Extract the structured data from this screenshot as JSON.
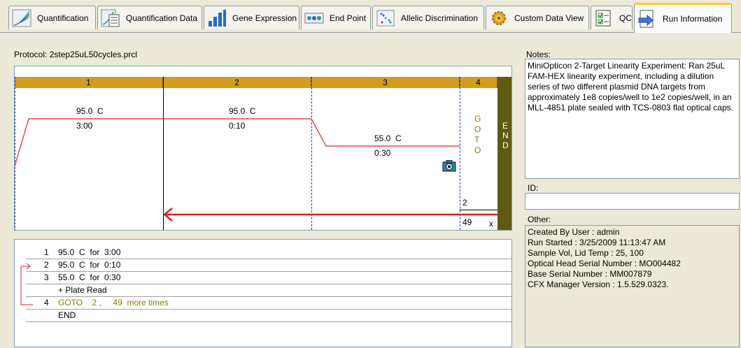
{
  "tabs": [
    {
      "label": "Quantification",
      "icon": "quantification-chart-icon",
      "active": false
    },
    {
      "label": "Quantification Data",
      "icon": "quantification-data-icon",
      "active": false
    },
    {
      "label": "Gene Expression",
      "icon": "gene-expression-bars-icon",
      "active": false
    },
    {
      "label": "End Point",
      "icon": "end-point-icon",
      "active": false
    },
    {
      "label": "Allelic Discrimination",
      "icon": "allelic-discrimination-icon",
      "active": false
    },
    {
      "label": "Custom Data View",
      "icon": "custom-data-view-gear-icon",
      "active": false
    },
    {
      "label": "QC",
      "icon": "qc-checklist-icon",
      "active": false
    },
    {
      "label": "Run Information",
      "icon": "run-information-icon",
      "active": true
    }
  ],
  "protocol": {
    "label": "Protocol: 2step25uL50cycles.prcl",
    "steps": [
      {
        "number": "1",
        "temp": "95.0",
        "unit": "C",
        "time": "3:00"
      },
      {
        "number": "2",
        "temp": "95.0",
        "unit": "C",
        "time": "0:10"
      },
      {
        "number": "3",
        "temp": "55.0",
        "unit": "C",
        "time": "0:30"
      },
      {
        "number": "4"
      }
    ],
    "goto_letters": [
      "G",
      "O",
      "T",
      "O"
    ],
    "end_letters": [
      "E",
      "N",
      "D"
    ],
    "goto_step": "2",
    "goto_repeats": "49",
    "goto_repeat_suffix": "x"
  },
  "step_list": [
    {
      "num": "1",
      "text": "95.0  C  for  3:00"
    },
    {
      "num": "2",
      "text": "95.0  C  for  0:10"
    },
    {
      "num": "3",
      "text": "55.0  C  for  0:30"
    },
    {
      "num": "",
      "text": "+ Plate Read"
    },
    {
      "num": "4",
      "text": "GOTO    2 ,     49  more times"
    },
    {
      "num": "",
      "text": "END"
    }
  ],
  "notes": {
    "label": "Notes:",
    "text": "MiniOpticon 2-Target Linearity Experiment: Ran 25uL FAM-HEX linearity experiment, including a dilution series of two different plasmid DNA targets from approximately 1e8 copies/well to 1e2 copies/well, in an MLL-4851 plate sealed with TCS-0803 flat optical caps."
  },
  "id": {
    "label": "ID:",
    "value": ""
  },
  "other": {
    "label": "Other:",
    "lines": [
      "Created By User : admin",
      "Run Started : 3/25/2009 11:13:47 AM",
      "Sample Vol, Lid Temp : 25, 100",
      "Optical Head Serial Number : MO004482",
      "Base Serial Number : MM007879",
      "CFX Manager Version : 1.5.529.0323."
    ]
  },
  "colors": {
    "header_bar": "#d39c21",
    "end_bar": "#5f5a10",
    "temp_line": "#e02020",
    "goto_text": "#8a7a10"
  }
}
